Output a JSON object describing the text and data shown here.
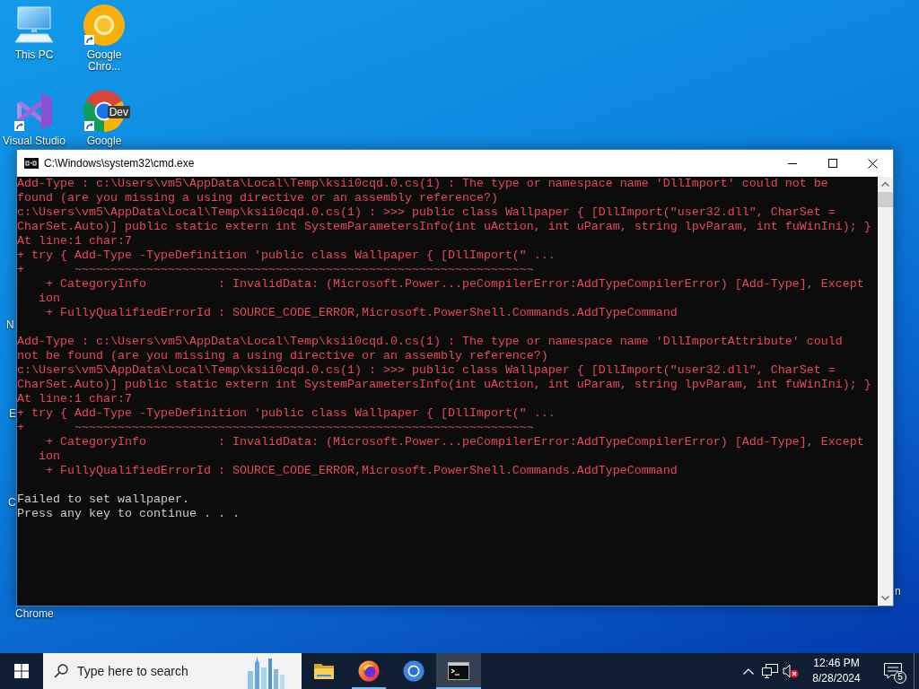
{
  "desktop": {
    "icons": [
      {
        "label": "This PC",
        "kind": "computer",
        "shortcut": false
      },
      {
        "label": "Visual Studio",
        "kind": "studio",
        "shortcut": true
      },
      {
        "label": "Google Chro...",
        "kind": "canary",
        "shortcut": true
      },
      {
        "label": "Google",
        "kind": "dev",
        "shortcut": true,
        "tag": "Dev"
      }
    ],
    "cut_labels": [
      {
        "text": "N"
      },
      {
        "text": "E"
      },
      {
        "text": "C"
      },
      {
        "text": "Chrome"
      },
      {
        "text": "n"
      }
    ]
  },
  "window": {
    "title": "C:\\Windows\\system32\\cmd.exe",
    "controls": [
      {
        "kind": "minimize"
      },
      {
        "kind": "maximize"
      },
      {
        "kind": "close"
      }
    ]
  },
  "console": {
    "blocks": [
      {
        "kind": "error",
        "lines": [
          "Add-Type : c:\\Users\\vm5\\AppData\\Local\\Temp\\ksii0cqd.0.cs(1) : The type or namespace name 'DllImport' could not be",
          "found (are you missing a using directive or an assembly reference?)",
          "c:\\Users\\vm5\\AppData\\Local\\Temp\\ksii0cqd.0.cs(1) : >>> public class Wallpaper { [DllImport(\"user32.dll\", CharSet =",
          "CharSet.Auto)] public static extern int SystemParametersInfo(int uAction, int uParam, string lpvParam, int fuWinIni); }",
          "At line:1 char:7",
          "+ try { Add-Type -TypeDefinition 'public class Wallpaper { [DllImport(\" ...",
          "+       ~~~~~~~~~~~~~~~~~~~~~~~~~~~~~~~~~~~~~~~~~~~~~~~~~~~~~~~~~~~~~~~~",
          "    + CategoryInfo          : InvalidData: (Microsoft.Power...peCompilerError:AddTypeCompilerError) [Add-Type], Except",
          "   ion",
          "    + FullyQualifiedErrorId : SOURCE_CODE_ERROR,Microsoft.PowerShell.Commands.AddTypeCommand"
        ]
      },
      {
        "kind": "error",
        "lines": [
          "Add-Type : c:\\Users\\vm5\\AppData\\Local\\Temp\\ksii0cqd.0.cs(1) : The type or namespace name 'DllImportAttribute' could",
          "not be found (are you missing a using directive or an assembly reference?)",
          "c:\\Users\\vm5\\AppData\\Local\\Temp\\ksii0cqd.0.cs(1) : >>> public class Wallpaper { [DllImport(\"user32.dll\", CharSet =",
          "CharSet.Auto)] public static extern int SystemParametersInfo(int uAction, int uParam, string lpvParam, int fuWinIni); }",
          "At line:1 char:7",
          "+ try { Add-Type -TypeDefinition 'public class Wallpaper { [DllImport(\" ...",
          "+       ~~~~~~~~~~~~~~~~~~~~~~~~~~~~~~~~~~~~~~~~~~~~~~~~~~~~~~~~~~~~~~~~",
          "    + CategoryInfo          : InvalidData: (Microsoft.Power...peCompilerError:AddTypeCompilerError) [Add-Type], Except",
          "   ion",
          "    + FullyQualifiedErrorId : SOURCE_CODE_ERROR,Microsoft.PowerShell.Commands.AddTypeCommand"
        ]
      },
      {
        "kind": "message",
        "lines": [
          "Failed to set wallpaper.",
          "Press any key to continue . . ."
        ]
      }
    ]
  },
  "taskbar": {
    "search": {
      "placeholder": "Type here to search"
    },
    "apps": [
      {
        "kind": "folder",
        "running": false,
        "selected": false
      },
      {
        "kind": "firefox",
        "running": true,
        "selected": false
      },
      {
        "kind": "chromium",
        "running": false,
        "selected": false
      },
      {
        "kind": "terminal",
        "running": true,
        "selected": true
      }
    ],
    "tray": {
      "volume_muted": true,
      "time": "12:46 PM",
      "date": "8/28/2024",
      "notification_count": "5"
    }
  }
}
